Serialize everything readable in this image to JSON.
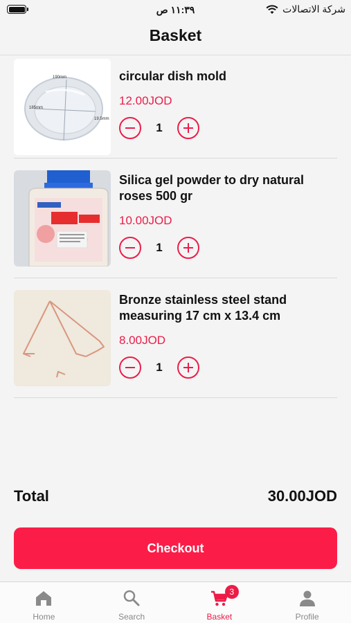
{
  "status_bar": {
    "time": "١١:٣٩ ص",
    "carrier": "شركة الاتصالات"
  },
  "header": {
    "title": "Basket"
  },
  "items": [
    {
      "name": "circular dish mold",
      "price": "12.00JOD",
      "quantity": "1",
      "image_labels": {
        "top": "190mm",
        "left": "185mm",
        "right": "19.5mm"
      }
    },
    {
      "name": "Silica gel powder to dry natural roses 500 gr",
      "price": "10.00JOD",
      "quantity": "1"
    },
    {
      "name": "Bronze stainless steel stand measuring 17 cm x 13.4 cm",
      "price": "8.00JOD",
      "quantity": "1"
    }
  ],
  "summary": {
    "total_label": "Total",
    "total_value": "30.00JOD"
  },
  "checkout": {
    "label": "Checkout"
  },
  "tabbar": {
    "tabs": [
      {
        "label": "Home",
        "icon": "home-icon"
      },
      {
        "label": "Search",
        "icon": "search-icon"
      },
      {
        "label": "Basket",
        "icon": "cart-icon",
        "badge": "3",
        "active": true
      },
      {
        "label": "Profile",
        "icon": "person-icon"
      }
    ]
  },
  "colors": {
    "accent": "#ec1c48",
    "checkout_bg": "#fb1d48",
    "background": "#f4f4f4"
  }
}
